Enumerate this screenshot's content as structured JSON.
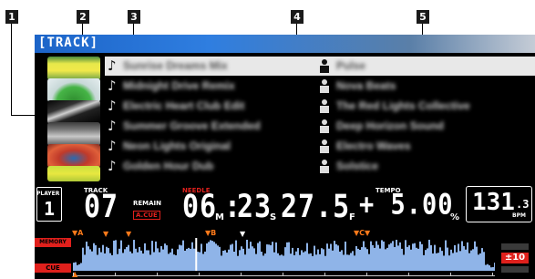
{
  "callouts": [
    "1",
    "2",
    "3",
    "4",
    "5"
  ],
  "browse": {
    "label": "TRACK",
    "rows": [
      {
        "title": "Sunrise Dreams Mix",
        "artist": "Pulse"
      },
      {
        "title": "Midnight Drive Remix",
        "artist": "Nova Beats"
      },
      {
        "title": "Electric Heart Club Edit",
        "artist": "The Red Lights Collective"
      },
      {
        "title": "Summer Groove Extended",
        "artist": "Deep Horizon Sound"
      },
      {
        "title": "Neon Lights Original",
        "artist": "Electro Waves"
      },
      {
        "title": "Golden Hour Dub",
        "artist": "Solstice"
      }
    ]
  },
  "deck": {
    "player_label": "PLAYER",
    "player_num": "1",
    "track_label": "TRACK",
    "track_num": "07",
    "remain_label": "REMAIN",
    "auto_cue_label": "A.CUE",
    "needle_label": "NEEDLE",
    "minutes": "06",
    "m_unit": "M",
    "seconds": "23",
    "s_unit": "S",
    "frames": "27.5",
    "f_unit": "F",
    "tempo_label": "TEMPO",
    "tempo_value": "+ 5.00",
    "tempo_unit": "%",
    "bpm_int": "131",
    "bpm_dec": ".3",
    "bpm_label": "BPM",
    "memory_label": "MEMORY",
    "cue_label": "CUE",
    "marker_a": "A",
    "marker_b": "B",
    "marker_c": "C",
    "tempo_range": "±10",
    "playhead_fraction": 0.29
  },
  "colors": {
    "accent_red": "#e0201c",
    "wave_blue": "#8fb4e8",
    "marker_orange": "#ff7a1a"
  }
}
